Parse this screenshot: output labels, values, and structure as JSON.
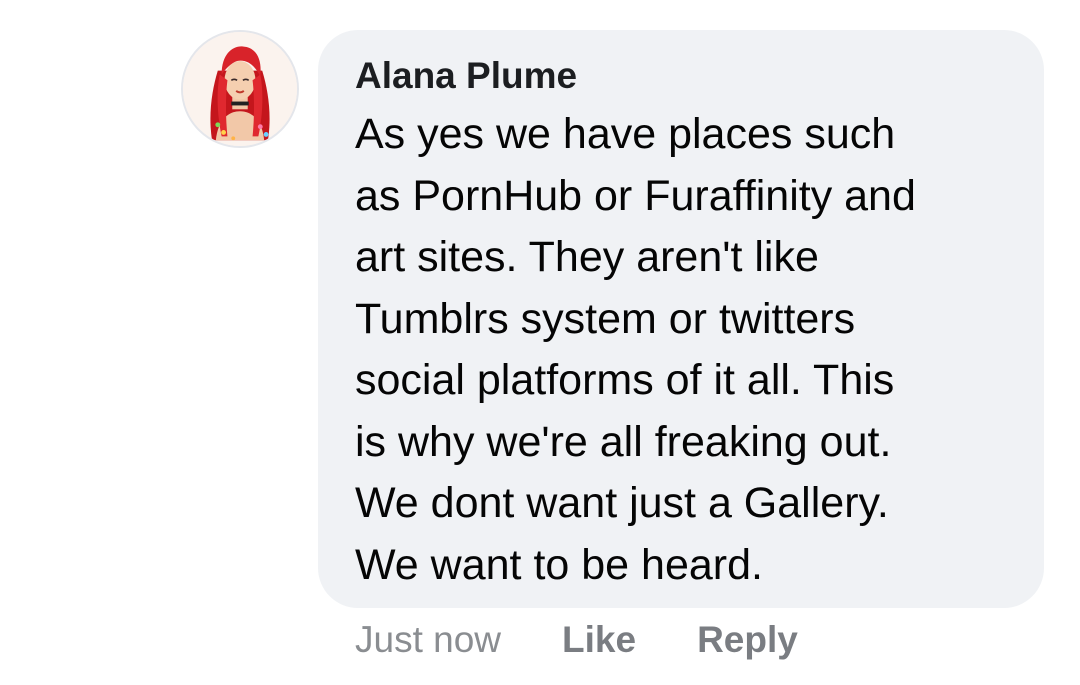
{
  "comment": {
    "author": "Alana Plume",
    "text": "As yes we have places such\nas PornHub or Furaffinity and\nart sites. They aren't like\nTumblrs system or twitters\nsocial platforms of it all. This\nis why we're all freaking out.\nWe dont want just a Gallery.\nWe want to be heard.",
    "timestamp": "Just now",
    "like_label": "Like",
    "reply_label": "Reply"
  },
  "colors": {
    "bubble_background": "#f0f2f5",
    "action_text": "#8a8d91",
    "name_text": "#1c1e21"
  },
  "icons": {
    "avatar": "profile-avatar-red-haired-illustration"
  }
}
